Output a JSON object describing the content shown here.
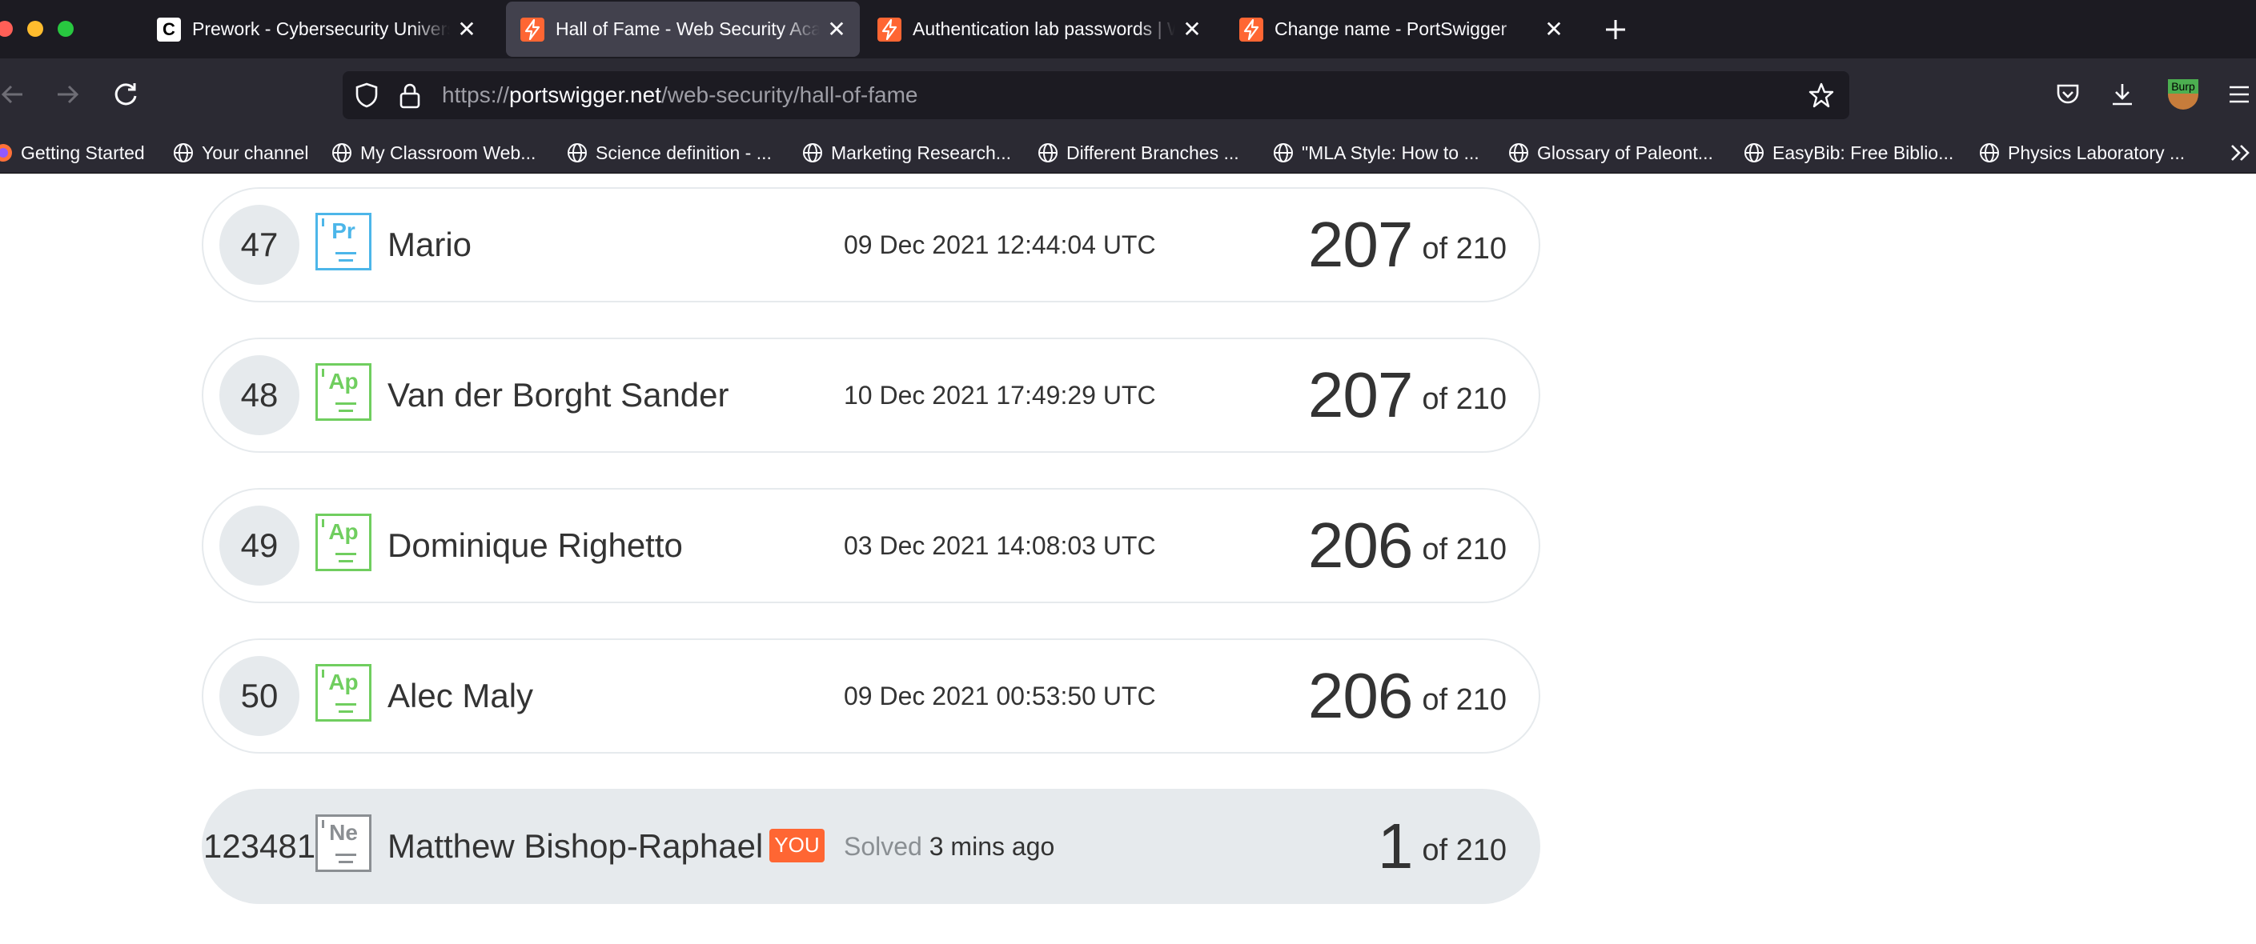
{
  "browser": {
    "tabs": [
      {
        "title": "Prework - Cybersecurity Universi",
        "favicon": "c-logo-icon",
        "active": false
      },
      {
        "title": "Hall of Fame - Web Security Aca",
        "favicon": "portswigger-icon",
        "active": true
      },
      {
        "title": "Authentication lab passwords | W",
        "favicon": "portswigger-icon",
        "active": false
      },
      {
        "title": "Change name - PortSwigger",
        "favicon": "portswigger-icon",
        "active": false
      }
    ],
    "url": {
      "scheme": "https://",
      "host": "portswigger.net",
      "path": "/web-security/hall-of-fame"
    },
    "extension_label": "Burp",
    "bookmarks": [
      "Getting Started",
      "Your channel",
      "My Classroom Web...",
      "Science definition - ...",
      "Marketing Research...",
      "Different Branches ...",
      "\"MLA Style: How to ...",
      "Glossary of Paleont...",
      "EasyBib: Free Biblio...",
      "Physics Laboratory ..."
    ]
  },
  "leaderboard": {
    "rows": [
      {
        "rank": "47",
        "badge": "Pr",
        "name": "Mario",
        "date": "09 Dec 2021 12:44:04 UTC",
        "score": "207",
        "of": "of 210"
      },
      {
        "rank": "48",
        "badge": "Ap",
        "name": "Van der Borght Sander",
        "date": "10 Dec 2021 17:49:29 UTC",
        "score": "207",
        "of": "of 210"
      },
      {
        "rank": "49",
        "badge": "Ap",
        "name": "Dominique Righetto",
        "date": "03 Dec 2021 14:08:03 UTC",
        "score": "206",
        "of": "of 210"
      },
      {
        "rank": "50",
        "badge": "Ap",
        "name": "Alec Maly",
        "date": "09 Dec 2021 00:53:50 UTC",
        "score": "206",
        "of": "of 210"
      }
    ],
    "me": {
      "rank": "123481",
      "badge": "Ne",
      "name": "Matthew Bishop-Raphael",
      "you_label": "YOU",
      "solved_label": "Solved",
      "solved_time": "3 mins ago",
      "score": "1",
      "of": "of 210"
    }
  },
  "colors": {
    "portswigger_orange": "#ff6633",
    "apprentice_green": "#70ce5f",
    "practitioner_blue": "#4cb6e9",
    "newcomer_grey": "#8b8f93",
    "row_grey": "#e6eaed"
  }
}
